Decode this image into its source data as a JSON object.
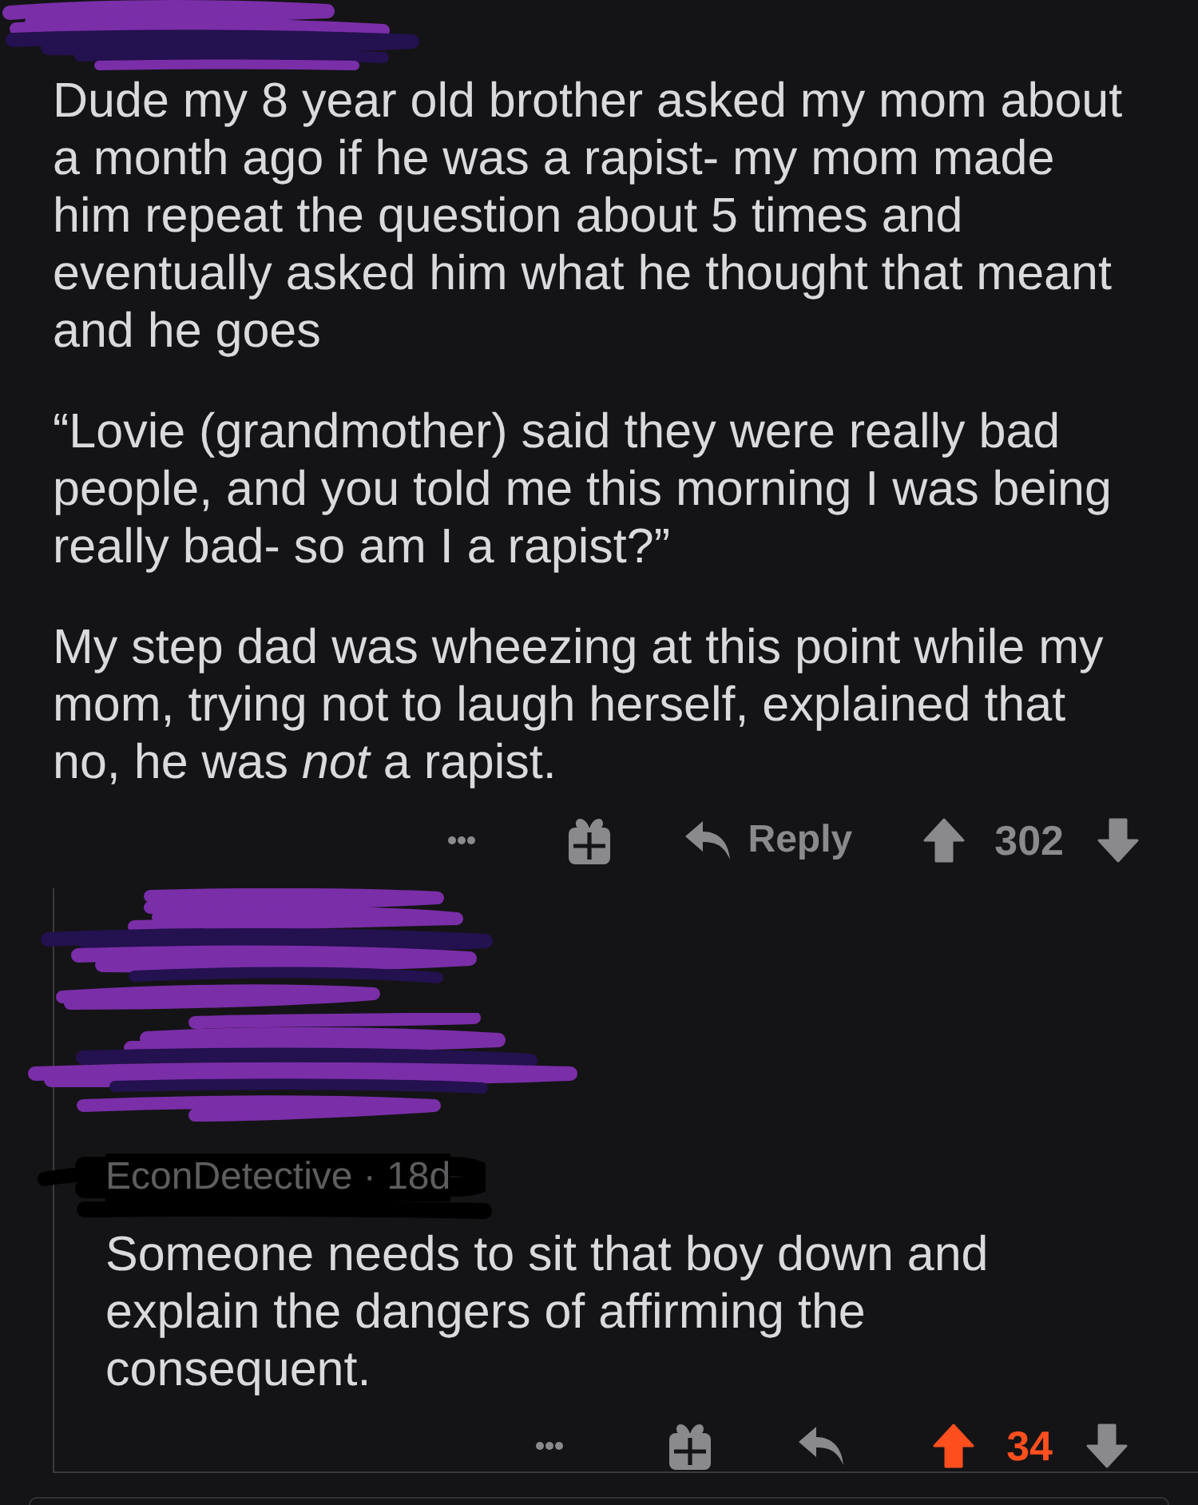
{
  "comment": {
    "paragraphs": [
      "Dude my 8 year old brother asked my mom about a month ago if he was a rapist- my mom made him repeat the question about 5 times and eventually asked him what he thought that meant and he goes",
      "“Lovie (grandmother) said they were really bad people, and you told me this morning I was being really bad- so am I a rapist?”",
      "My step dad was wheezing at this point while my mom, trying not to laugh herself, explained that no, he was *not* a rapist."
    ],
    "actions": {
      "reply_label": "Reply",
      "score": "302",
      "upvoted": false,
      "downvoted": false
    }
  },
  "reply": {
    "byline": "EconDetective · 18d",
    "body": "Someone needs to sit that boy down and explain the dangers of affirming the consequent.",
    "actions": {
      "score": "34",
      "upvoted": true,
      "downvoted": false
    }
  }
}
